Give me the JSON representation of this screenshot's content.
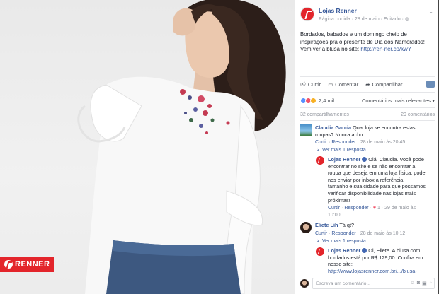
{
  "brand": {
    "logo_text": "RENNER"
  },
  "post": {
    "page_name": "Lojas Renner",
    "meta": [
      "Página curtida",
      "28 de maio",
      "Editado"
    ],
    "text_lines": [
      "Bordados, babados e um domingo cheio de",
      "inspirações pra o presente de Dia dos Namorados!",
      "Vem ver a blusa no site: "
    ],
    "link": "http://ren-ner.co/kwY",
    "actions": {
      "like": "Curtir",
      "comment": "Comentar",
      "share": "Compartilhar"
    },
    "reaction_count": "2,4 mil",
    "relevance": "Comentários mais relevantes",
    "shares": "32 compartilhamentos",
    "comments": "29 comentários"
  },
  "comments": [
    {
      "author": "Claudia Garcia",
      "text_lines": [
        "Qual loja se encontra estas",
        "roupas? Nunca acho"
      ],
      "like": "Curtir",
      "reply": "Responder",
      "time": "28 de maio às 20:45",
      "more_replies": "Ver mais 1 resposta"
    },
    {
      "author": "Lojas Renner",
      "text_lines": [
        "Olá, Claudia. Você pode",
        "encontrar no site e se não encontrar a",
        "roupa que deseja em uma loja física, pode",
        "nos enviar por inbox a referência,",
        "tamanho e sua cidade para que possamos",
        "verificar disponibilidade nas lojas mais",
        "próximas!"
      ],
      "like": "Curtir",
      "reply": "Responder",
      "reactions": "1",
      "time": "29 de maio às",
      "time2": "10:00"
    },
    {
      "author": "Eliete Lih",
      "text_lines": [
        "Tá qt?"
      ],
      "like": "Curtir",
      "reply": "Responder",
      "time": "28 de maio às 10:12",
      "more_replies": "Ver mais 1 resposta"
    },
    {
      "author": "Lojas Renner",
      "text_lines": [
        "Oi, Eliete. A blusa com",
        "bordados está por R$ 129,00. Confira em",
        "nosso site:"
      ],
      "link": "http://www.lojasrenner.com.br/.../blusa-"
    }
  ],
  "composer": {
    "placeholder": "Escreva um comentário..."
  },
  "colors": {
    "accent": "#365899",
    "brand": "#e3252b"
  }
}
